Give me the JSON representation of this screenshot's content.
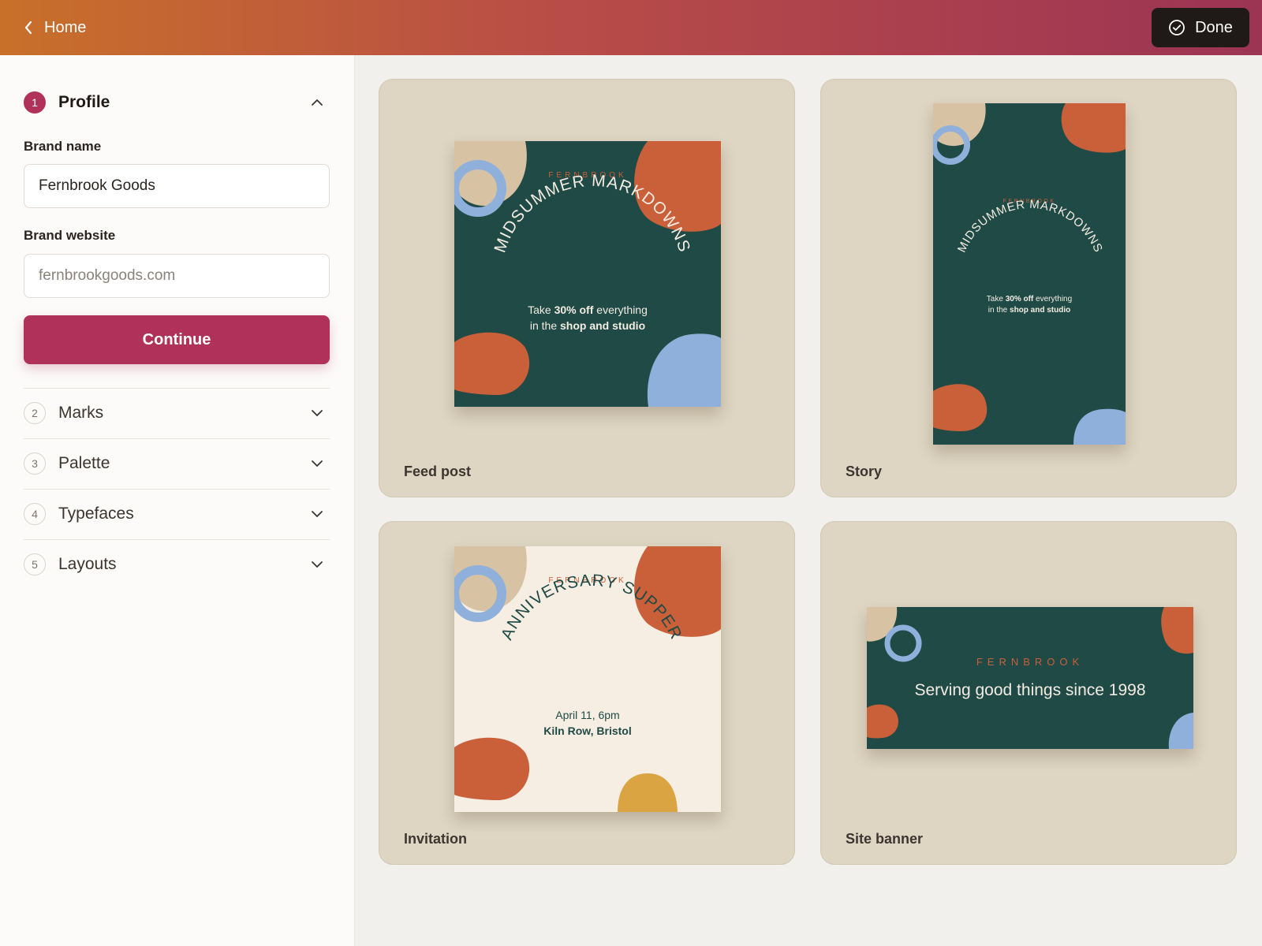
{
  "header": {
    "back_label": "Home",
    "done_label": "Done"
  },
  "sidebar": {
    "steps": [
      {
        "num": "1",
        "label": "Profile",
        "expanded": true
      },
      {
        "num": "2",
        "label": "Marks",
        "expanded": false
      },
      {
        "num": "3",
        "label": "Palette",
        "expanded": false
      },
      {
        "num": "4",
        "label": "Typefaces",
        "expanded": false
      },
      {
        "num": "5",
        "label": "Layouts",
        "expanded": false
      }
    ],
    "profile": {
      "brand_name_label": "Brand name",
      "brand_name_value": "Fernbrook Goods",
      "brand_website_label": "Brand website",
      "brand_website_placeholder": "fernbrookgoods.com",
      "continue_label": "Continue"
    }
  },
  "previews": {
    "feed_post": {
      "label": "Feed post",
      "brand": "FERNBROOK",
      "headline": "MIDSUMMER MARKDOWNS",
      "body_pre": "Take ",
      "body_bold": "30% off",
      "body_post": " everything",
      "body2_pre": "in the ",
      "body2_bold": "shop and studio"
    },
    "story": {
      "label": "Story",
      "brand": "FERNBROOK",
      "headline": "MIDSUMMER MARKDOWNS",
      "body_pre": "Take ",
      "body_bold": "30% off",
      "body_post": " everything",
      "body2_pre": "in the ",
      "body2_bold": "shop and studio"
    },
    "invitation": {
      "label": "Invitation",
      "brand": "FERNBROOK",
      "headline": "ANNIVERSARY SUPPER",
      "date": "April 11, 6pm",
      "place": "Kiln Row, Bristol"
    },
    "site_banner": {
      "label": "Site banner",
      "brand": "FERNBROOK",
      "tagline": "Serving good things since 1998"
    }
  },
  "colors": {
    "accent": "#b0325a",
    "forest": "#1f4a45",
    "orange": "#c9603a",
    "blue": "#8fb0da",
    "sand": "#d7c3a4",
    "cream": "#f6eee3",
    "mustard": "#d9a441"
  },
  "icons": {
    "back": "chevron-left-icon",
    "done": "check-circle-icon",
    "collapse": "chevron-up-icon",
    "expand": "chevron-down-icon"
  }
}
